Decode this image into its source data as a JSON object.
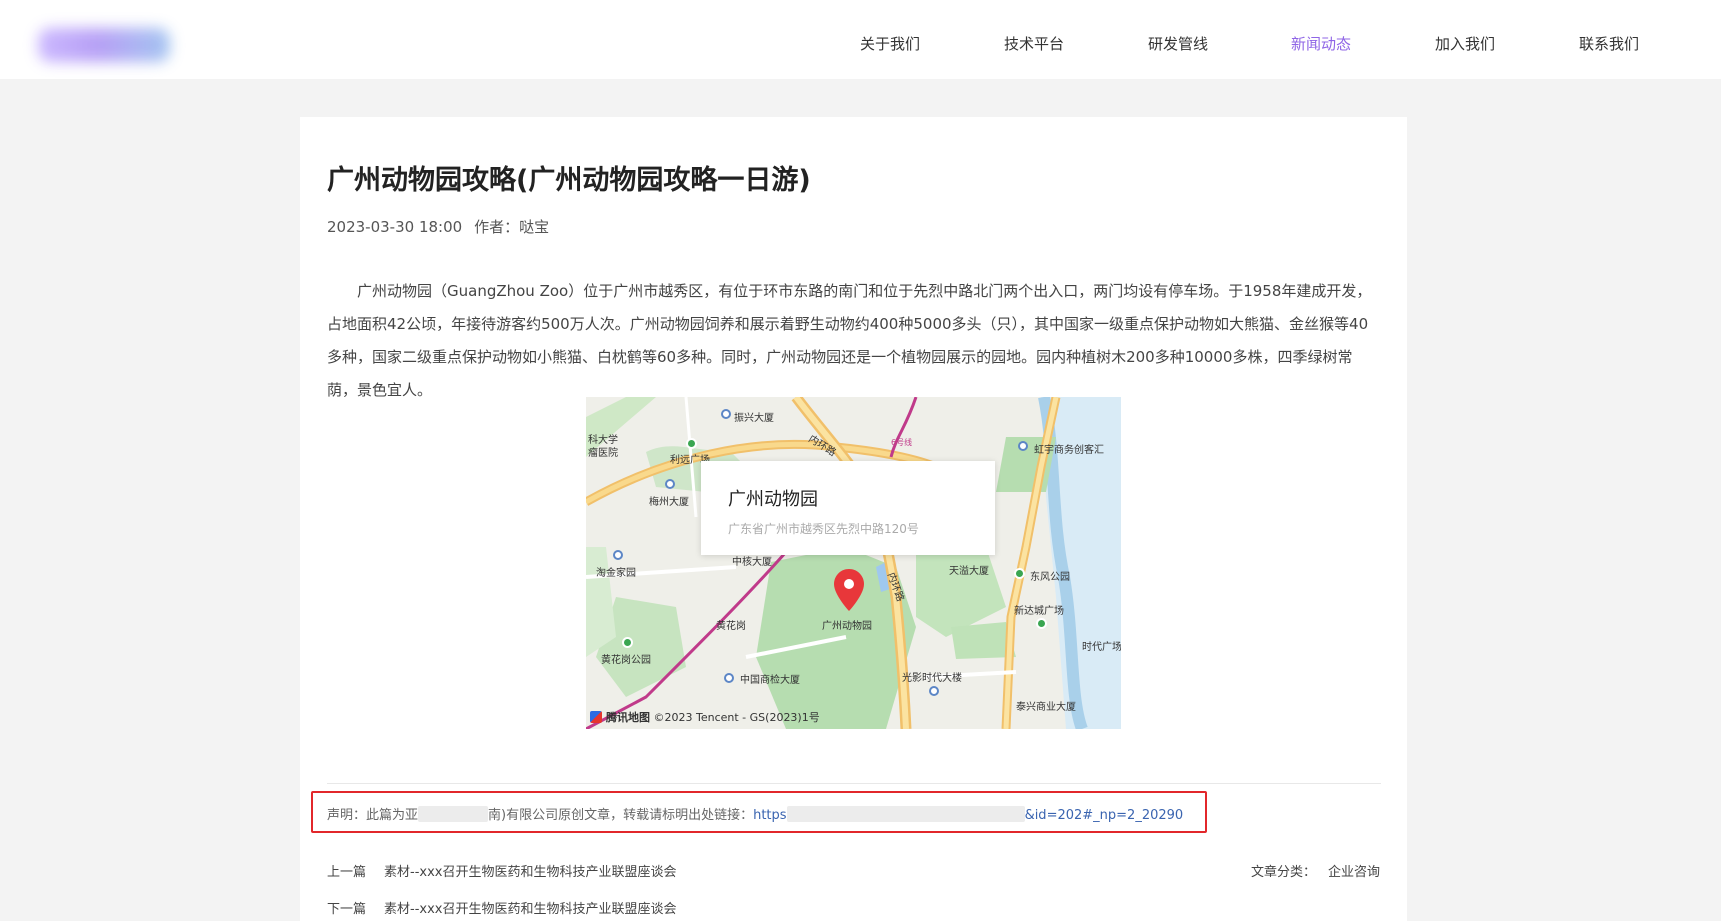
{
  "nav": {
    "items": [
      {
        "label": "关于我们",
        "active": false
      },
      {
        "label": "技术平台",
        "active": false
      },
      {
        "label": "研发管线",
        "active": false
      },
      {
        "label": "新闻动态",
        "active": true
      },
      {
        "label": "加入我们",
        "active": false
      },
      {
        "label": "联系我们",
        "active": false
      }
    ]
  },
  "article": {
    "title": "广州动物园攻略(广州动物园攻略一日游)",
    "date": "2023-03-30 18:00",
    "author": "作者：哒宝",
    "body": "广州动物园（GuangZhou Zoo）位于广州市越秀区，有位于环市东路的南门和位于先烈中路北门两个出入口，两门均设有停车场。于1958年建成开发，占地面积42公顷，年接待游客约500万人次。广州动物园饲养和展示着野生动物约400种5000多头（只），其中国家一级重点保护动物如大熊猫、金丝猴等40多种，国家二级重点保护动物如小熊猫、白枕鹤等60多种。同时，广州动物园还是一个植物园展示的园地。园内种植树木200多种10000多株，四季绿树常荫，景色宜人。"
  },
  "map": {
    "popup_name": "广州动物园",
    "popup_address": "广东省广州市越秀区先烈中路120号",
    "marker_label": "广州动物园",
    "footer_brand": "腾讯地图",
    "footer_copyright": "©2023 Tencent - GS(2023)1号",
    "labels": {
      "l1": "振兴大厦",
      "l2": "科大学",
      "l3": "瘤医院",
      "l4": "利远广场",
      "l5": "内环路",
      "l6": "虹宇商务创客汇",
      "l7": "梅州大厦",
      "l8": "淘金家园",
      "l9": "中核大厦",
      "l10": "天溢大厦",
      "l11": "东风公园",
      "l12": "新达城广场",
      "l13": "黄花岗",
      "l14": "时代广场",
      "l15": "黄花岗公园",
      "l16": "中国商检大厦",
      "l17": "光影时代大楼",
      "l18": "泰兴商业大厦",
      "l19": "内环路",
      "l20": "6号线"
    }
  },
  "statement": {
    "prefix": "声明：此篇为亚",
    "middle": "南)有限公司原创文章，转载请标明出处链接：",
    "link_start": "https",
    "link_end": "&id=202#_np=2_20290"
  },
  "prev": {
    "label": "上一篇",
    "title": "素材--xxx召开生物医药和生物科技产业联盟座谈会"
  },
  "next": {
    "label": "下一篇",
    "title": "素材--xxx召开生物医药和生物科技产业联盟座谈会"
  },
  "category": {
    "label": "文章分类：",
    "value": "企业咨询"
  },
  "colors": {
    "accent": "#8f65e6",
    "link": "#3a64b0",
    "statement_border": "#e2272b",
    "marker": "#e8373a"
  }
}
